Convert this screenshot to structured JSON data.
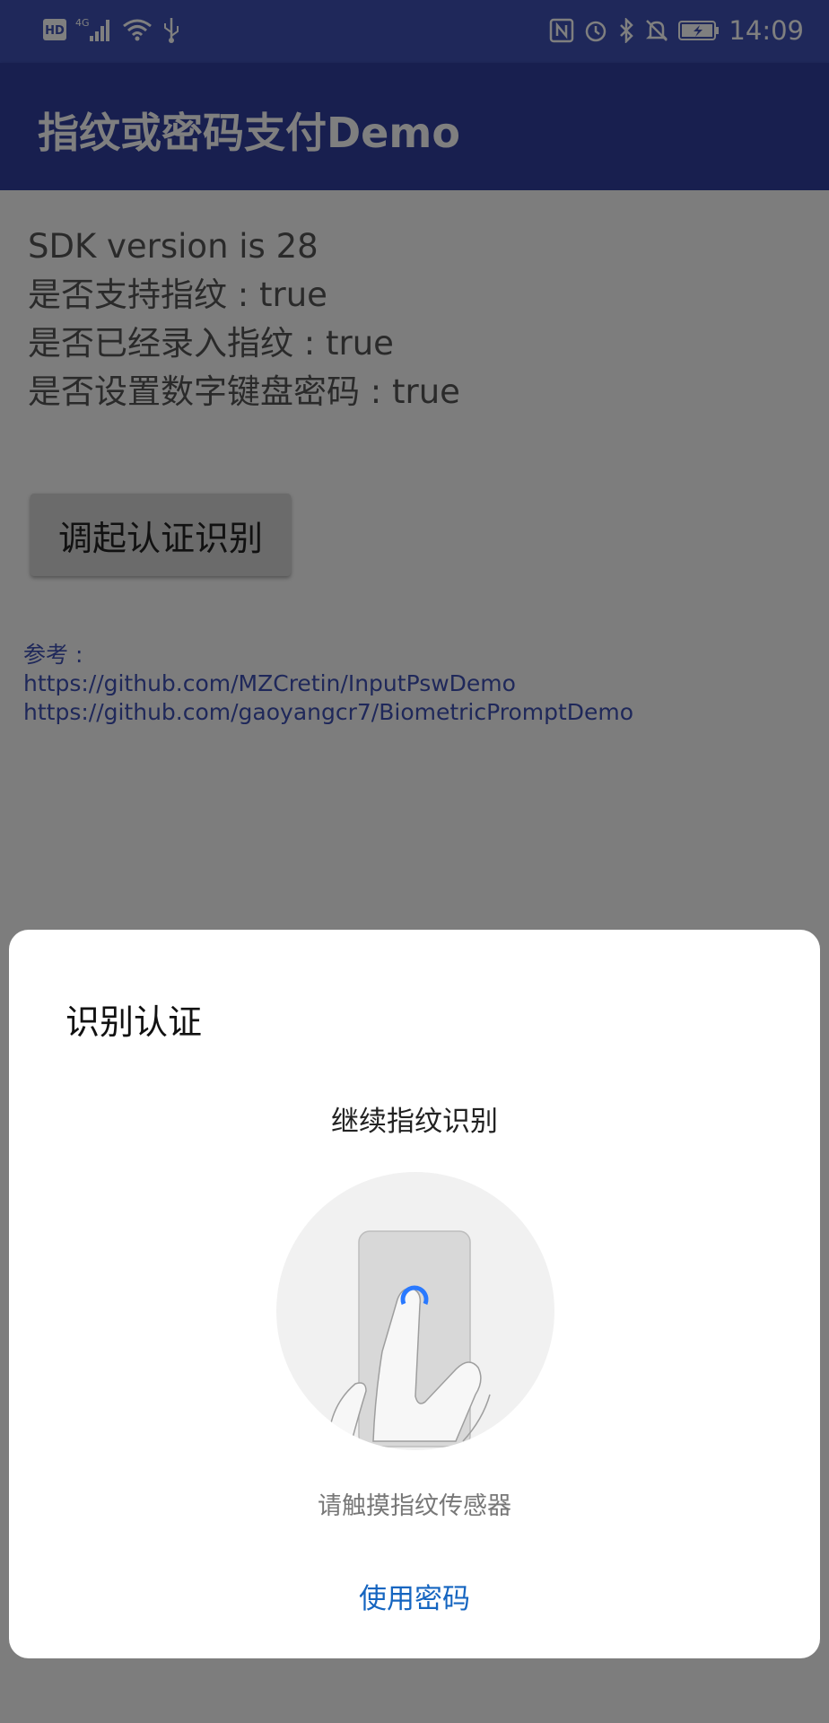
{
  "status_bar": {
    "time": "14:09",
    "network_label": "HD",
    "network_gen": "4G",
    "icons_left": [
      "hd-icon",
      "cellular-signal-icon",
      "wifi-icon",
      "usb-icon"
    ],
    "icons_right": [
      "nfc-icon",
      "alarm-icon",
      "bluetooth-icon",
      "notifications-off-icon",
      "battery-charging-icon"
    ]
  },
  "app_bar": {
    "title": "指纹或密码支付Demo"
  },
  "info": {
    "sdk": "SDK version is 28",
    "support": "是否支持指纹 : true",
    "enrolled": "是否已经录入指纹 : true",
    "pin_set": "是否设置数字键盘密码 : true"
  },
  "main_button": {
    "label": "调起认证识别"
  },
  "references": {
    "label": "参考 :",
    "link1": " https://github.com/MZCretin/InputPswDemo",
    "link2": "https://github.com/gaoyangcr7/BiometricPromptDemo"
  },
  "dialog": {
    "title": "识别认证",
    "subtitle": "继续指纹识别",
    "hint": "请触摸指纹传感器",
    "use_password": "使用密码"
  },
  "colors": {
    "primary": "#3f51b5",
    "primary_dark": "#303f9f",
    "accent_link": "#1565c0",
    "fingerprint_ring": "#2979ff"
  }
}
